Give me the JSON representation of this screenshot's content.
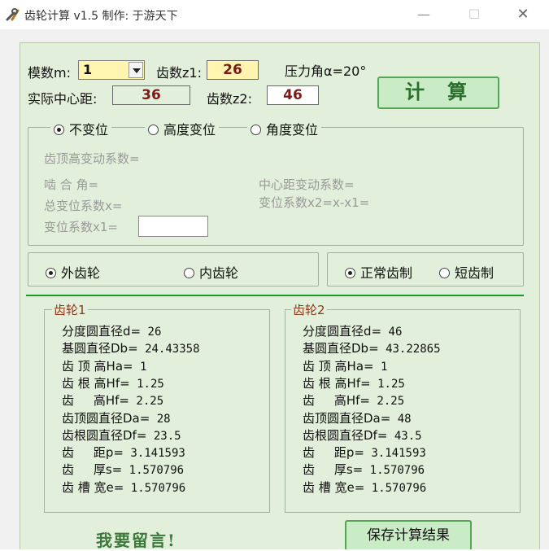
{
  "window": {
    "title": "齿轮计算 v1.5  制作: 于游天下",
    "minimize_glyph": "—",
    "maximize_glyph": "☐",
    "close_glyph": "✕",
    "app_icon": "tools-icon"
  },
  "inputs": {
    "module_label": "模数m:",
    "module_value": "1",
    "z1_label": "齿数z1:",
    "z1_value": "26",
    "pressure_angle": "压力角α=20°",
    "center_label": "实际中心距:",
    "center_value": "36",
    "z2_label": "齿数z2:",
    "z2_value": "46",
    "calc_label": "计算"
  },
  "shift": {
    "options": [
      "不变位",
      "高度变位",
      "角度变位"
    ],
    "selected": 0,
    "addendum_coef": "齿顶高变动系数=",
    "mesh_angle": "啮 合 角=",
    "center_shift_coef": "中心距变动系数=",
    "total_shift": "总变位系数x=",
    "x2_formula": "变位系数x2=x-x1=",
    "x1_label": "变位系数x1="
  },
  "gear_type": {
    "options": [
      "外齿轮",
      "内齿轮"
    ],
    "selected": 0
  },
  "tooth_system": {
    "options": [
      "正常齿制",
      "短齿制"
    ],
    "selected": 0
  },
  "gear1": {
    "title": "齿轮1",
    "lines": [
      {
        "label": "分度圆直径d=",
        "value": " 26"
      },
      {
        "label": "基圆直径Db=",
        "value": " 24.43358"
      },
      {
        "label": "齿 顶 高Ha=",
        "value": " 1"
      },
      {
        "label": "齿 根 高Hf=",
        "value": " 1.25"
      },
      {
        "label": "齿     高Hf=",
        "value": " 2.25"
      },
      {
        "label": "齿顶圆直径Da=",
        "value": " 28"
      },
      {
        "label": "齿根圆直径Df=",
        "value": " 23.5"
      },
      {
        "label": "齿     距p=",
        "value": " 3.141593"
      },
      {
        "label": "齿     厚s=",
        "value": " 1.570796"
      },
      {
        "label": "齿 槽 宽e=",
        "value": " 1.570796"
      }
    ]
  },
  "gear2": {
    "title": "齿轮2",
    "lines": [
      {
        "label": "分度圆直径d=",
        "value": " 46"
      },
      {
        "label": "基圆直径Db=",
        "value": " 43.22865"
      },
      {
        "label": "齿 顶 高Ha=",
        "value": " 1"
      },
      {
        "label": "齿 根 高Hf=",
        "value": " 1.25"
      },
      {
        "label": "齿     高Hf=",
        "value": " 2.25"
      },
      {
        "label": "齿顶圆直径Da=",
        "value": " 48"
      },
      {
        "label": "齿根圆直径Df=",
        "value": " 43.5"
      },
      {
        "label": "齿     距p=",
        "value": " 3.141593"
      },
      {
        "label": "齿     厚s=",
        "value": " 1.570796"
      },
      {
        "label": "齿 槽 宽e=",
        "value": " 1.570796"
      }
    ]
  },
  "footer": {
    "message_link": "我要留言!",
    "save_button": "保存计算结果"
  },
  "colors": {
    "panel_bg": "#e2efda",
    "accent_green": "#1a9a2a",
    "button_bg": "#c9ebc6",
    "value_dark_red": "#7a1a1a",
    "input_yellow": "#fff5b0"
  }
}
